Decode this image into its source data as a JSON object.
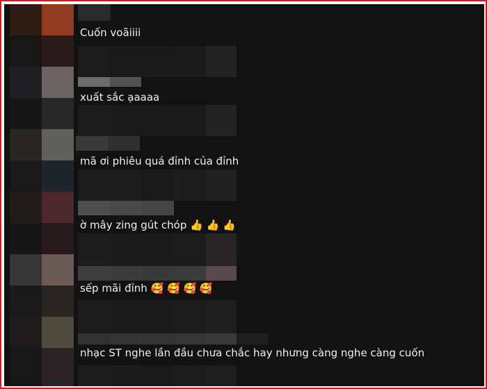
{
  "comments": [
    {
      "text": "Cuốn voãiiii",
      "emojis": ""
    },
    {
      "text": "xuất sắc ạaaaa",
      "emojis": ""
    },
    {
      "text": "mã ơi phiêu quá đỉnh của đỉnh",
      "emojis": ""
    },
    {
      "text": "ờ mây zing gút chóp",
      "emojis": "👍 👍 👍"
    },
    {
      "text": "sếp mãi đỉnh",
      "emojis": "🥰 🥰 🥰 🥰"
    },
    {
      "text": "nhạc ST nghe lần đầu chưa chắc hay nhưng càng nghe càng cuốn",
      "emojis": ""
    }
  ],
  "colors": {
    "frame_border": "#e5141b",
    "background": "#121212",
    "text": "#f1f1f1"
  }
}
